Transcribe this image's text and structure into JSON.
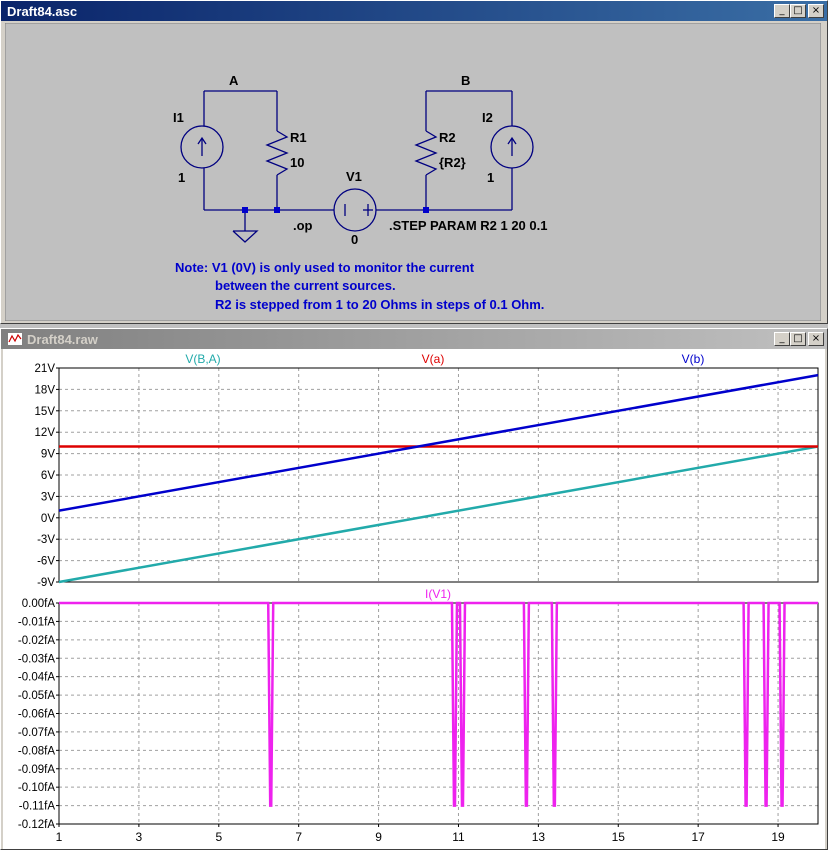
{
  "schematic_window": {
    "title": "Draft84.asc",
    "buttons": {
      "minimize": "_",
      "maximize": "□",
      "close": "×"
    },
    "labels": {
      "A": "A",
      "B": "B",
      "I1": "I1",
      "I1_val": "1",
      "R1": "R1",
      "R1_val": "10",
      "V1": "V1",
      "V1_val": "0",
      "R2": "R2",
      "R2_val": "{R2}",
      "I2": "I2",
      "I2_val": "1",
      "op": ".op",
      "step": ".STEP PARAM R2 1 20 0.1"
    },
    "note": [
      "Note: V1 (0V) is only used to monitor the current",
      "between the current sources.",
      "R2 is stepped from 1 to 20 Ohms in steps of 0.1 Ohm."
    ]
  },
  "plot_window": {
    "title": "Draft84.raw",
    "buttons": {
      "minimize": "_",
      "maximize": "□",
      "close": "×"
    }
  },
  "chart_data": [
    {
      "type": "line",
      "title": "",
      "series": [
        {
          "name": "V(B,A)",
          "color": "#22aaaa",
          "x": [
            1,
            20
          ],
          "values": [
            -9,
            10
          ]
        },
        {
          "name": "V(a)",
          "color": "#dd0000",
          "x": [
            1,
            20
          ],
          "values": [
            10,
            10
          ]
        },
        {
          "name": "V(b)",
          "color": "#0000cc",
          "x": [
            1,
            20
          ],
          "values": [
            1,
            20
          ]
        }
      ],
      "xlim": [
        1,
        20
      ],
      "ylim": [
        -9,
        21
      ],
      "yticks": [
        "21V",
        "18V",
        "15V",
        "12V",
        "9V",
        "6V",
        "3V",
        "0V",
        "-3V",
        "-6V",
        "-9V"
      ],
      "ytick_values": [
        21,
        18,
        15,
        12,
        9,
        6,
        3,
        0,
        -3,
        -6,
        -9
      ],
      "grid": true
    },
    {
      "type": "line",
      "title": "",
      "series": [
        {
          "name": "I(V1)",
          "color": "#ee22ee",
          "spikes": [
            {
              "x": 6.3,
              "depth": -0.11
            },
            {
              "x": 10.9,
              "depth": -0.11
            },
            {
              "x": 11.1,
              "depth": -0.11
            },
            {
              "x": 12.7,
              "depth": -0.11
            },
            {
              "x": 13.4,
              "depth": -0.11
            },
            {
              "x": 18.2,
              "depth": -0.11
            },
            {
              "x": 18.7,
              "depth": -0.11
            },
            {
              "x": 19.1,
              "depth": -0.11
            }
          ]
        }
      ],
      "xlim": [
        1,
        20
      ],
      "ylim": [
        -0.12,
        0
      ],
      "yticks": [
        "0.00fA",
        "-0.01fA",
        "-0.02fA",
        "-0.03fA",
        "-0.04fA",
        "-0.05fA",
        "-0.06fA",
        "-0.07fA",
        "-0.08fA",
        "-0.09fA",
        "-0.10fA",
        "-0.11fA",
        "-0.12fA"
      ],
      "ytick_values": [
        0,
        -0.01,
        -0.02,
        -0.03,
        -0.04,
        -0.05,
        -0.06,
        -0.07,
        -0.08,
        -0.09,
        -0.1,
        -0.11,
        -0.12
      ],
      "xticks": [
        "1",
        "3",
        "5",
        "7",
        "9",
        "11",
        "13",
        "15",
        "17",
        "19"
      ],
      "xtick_values": [
        1,
        3,
        5,
        7,
        9,
        11,
        13,
        15,
        17,
        19
      ],
      "grid": true
    }
  ]
}
